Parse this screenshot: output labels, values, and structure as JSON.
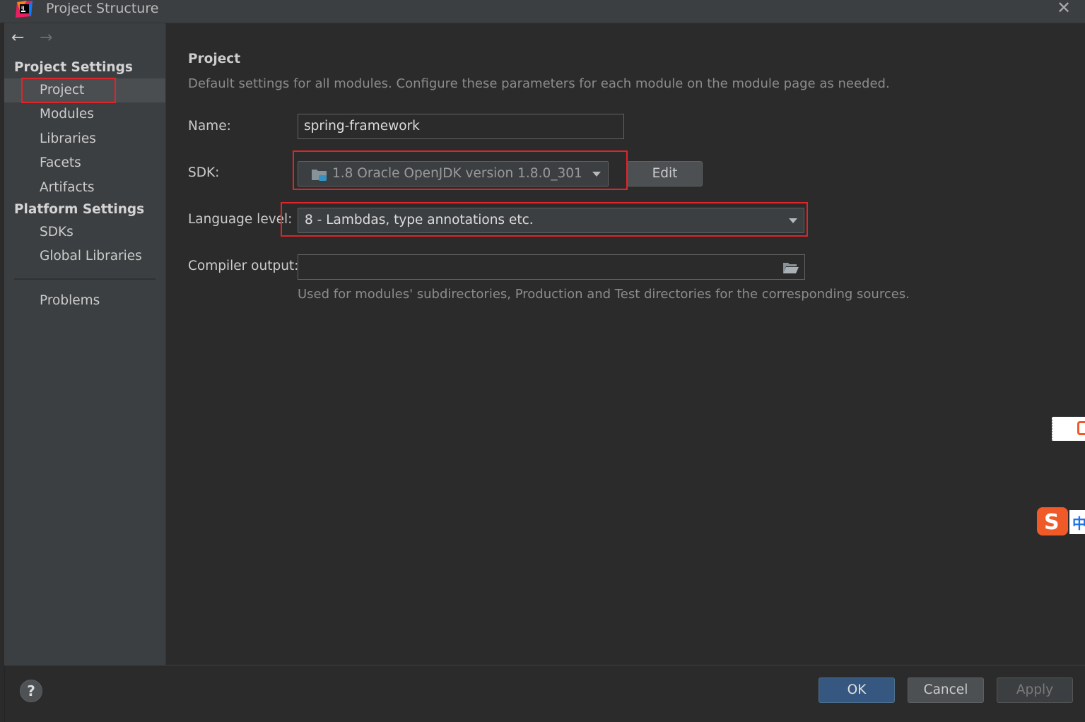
{
  "window": {
    "title": "Project Structure",
    "close_icon": "close-icon",
    "app_icon": "intellij-idea-icon"
  },
  "nav": {
    "back_icon": "arrow-left-icon",
    "forward_icon": "arrow-right-icon"
  },
  "sidebar": {
    "project_settings_header": "Project Settings",
    "project_items": [
      "Project",
      "Modules",
      "Libraries",
      "Facets",
      "Artifacts"
    ],
    "platform_settings_header": "Platform Settings",
    "platform_items": [
      "SDKs",
      "Global Libraries"
    ],
    "problems": "Problems",
    "selected": "Project"
  },
  "main": {
    "title": "Project",
    "description": "Default settings for all modules. Configure these parameters for each module on the module page as needed.",
    "name_label": "Name:",
    "name_value": "spring-framework",
    "sdk_label": "SDK:",
    "sdk_value": "1.8 Oracle OpenJDK version 1.8.0_301",
    "sdk_edit_button": "Edit",
    "language_level_label": "Language level:",
    "language_level_value": "8 - Lambdas, type annotations etc.",
    "compiler_output_label": "Compiler output:",
    "compiler_output_value": "",
    "compiler_output_hint": "Used for modules' subdirectories, Production and Test directories for the corresponding sources."
  },
  "footer": {
    "help_label": "?",
    "ok": "OK",
    "cancel": "Cancel",
    "apply": "Apply"
  },
  "colors": {
    "highlight_box": "#e0242a",
    "ok_button": "#365880",
    "background": "#2b2b2b",
    "sidebar": "#3c3f41"
  }
}
